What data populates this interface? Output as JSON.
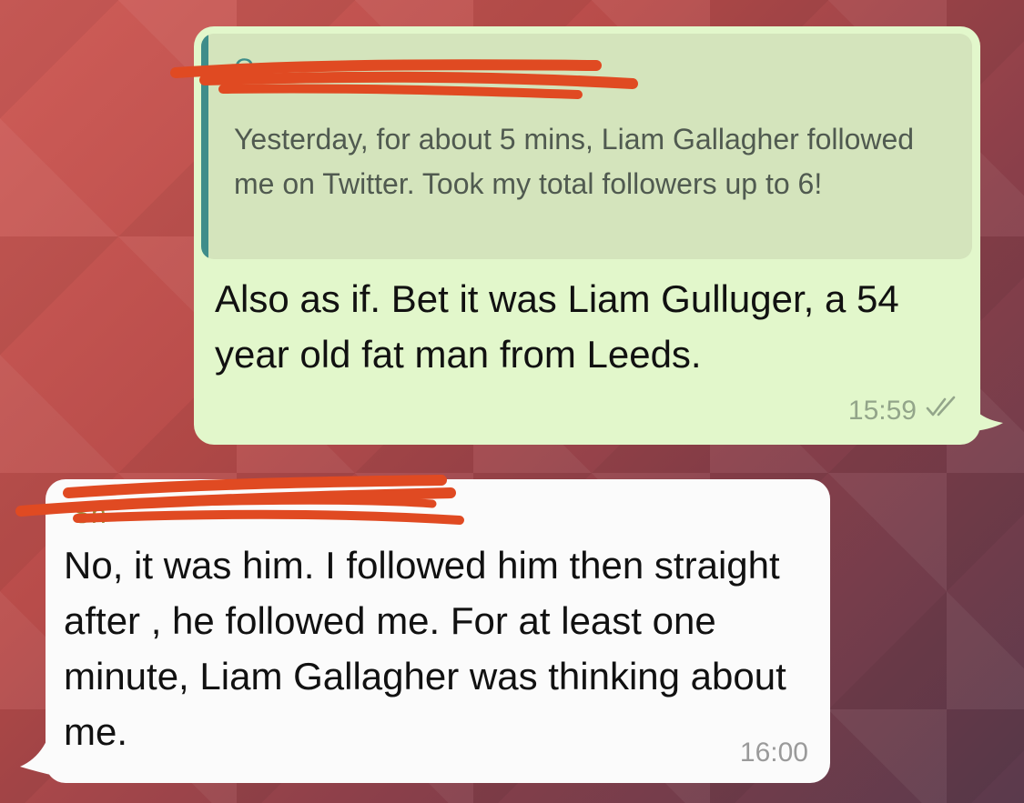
{
  "thread": {
    "outgoing": {
      "quote": {
        "sender": "Cor",
        "text": "Yesterday, for about 5 mins, Liam Gallagher followed me on Twitter. Took my total followers up to 6!"
      },
      "text": "Also as if. Bet it was Liam Gulluger, a 54 year old fat man from Leeds.",
      "time": "15:59",
      "status_icon": "double-check-icon"
    },
    "incoming": {
      "sender": "Sh",
      "text": "No, it was him. I followed him then straight after , he followed me. For at least one minute, Liam Gallagher was thinking about me.",
      "time": "16:00"
    }
  },
  "colors": {
    "outgoing_bubble": "#e2f7cb",
    "incoming_bubble": "#fbfbfb",
    "quote_accent": "#3f8d8a",
    "redaction": "#e04a22"
  }
}
